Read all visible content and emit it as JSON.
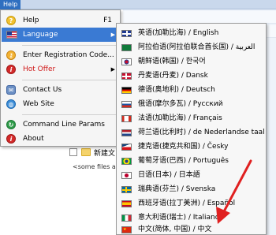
{
  "menubar": {
    "help_label": "Help"
  },
  "file_list": {
    "folder_name": "新建文",
    "note": "<some files a."
  },
  "main_menu": {
    "help": {
      "label": "Help",
      "shortcut": "F1",
      "icon": "help-icon"
    },
    "language": {
      "label": "Language",
      "icon": "us-flag-icon"
    },
    "registration": {
      "label": "Enter Registration Code...",
      "icon": "key-icon"
    },
    "hot_offer": {
      "label": "Hot Offer",
      "icon": "info-icon",
      "color": "#d01818"
    },
    "contact": {
      "label": "Contact Us",
      "icon": "contact-icon"
    },
    "website": {
      "label": "Web Site",
      "icon": "globe-icon"
    },
    "cmdline": {
      "label": "Command Line Params",
      "icon": "cmd-icon"
    },
    "about": {
      "label": "About",
      "icon": "info-icon"
    }
  },
  "languages": [
    {
      "label": "英语(加勒比海) / English",
      "flag": "gb"
    },
    {
      "label": "阿拉伯语(阿拉伯联合酋长国) / العربية",
      "flag": "sa"
    },
    {
      "label": "朝鲜语(韩国) / 한국어",
      "flag": "kr"
    },
    {
      "label": "丹麦语(丹麦) / Dansk",
      "flag": "dk"
    },
    {
      "label": "德语(奥地利) / Deutsch",
      "flag": "de"
    },
    {
      "label": "俄语(摩尔多瓦) / Русский",
      "flag": "ru"
    },
    {
      "label": "法语(加勒比海) / Français",
      "flag": "ca"
    },
    {
      "label": "荷兰语(比利时) / de Nederlandse taal",
      "flag": "nl"
    },
    {
      "label": "捷克语(捷克共和国) / Česky",
      "flag": "cz"
    },
    {
      "label": "葡萄牙语(巴西) / Português",
      "flag": "br"
    },
    {
      "label": "日语(日本) / 日本語",
      "flag": "jp"
    },
    {
      "label": "瑞典语(芬兰) / Svenska",
      "flag": "se"
    },
    {
      "label": "西班牙语(拉丁美洲) / Español",
      "flag": "es"
    },
    {
      "label": "意大利语(瑞士) / Italiano",
      "flag": "it"
    },
    {
      "label": "中文(简体, 中国) / 中文",
      "flag": "cn"
    }
  ],
  "colors": {
    "selection": "#3a7ad3",
    "annotation_arrow": "#e02020"
  }
}
